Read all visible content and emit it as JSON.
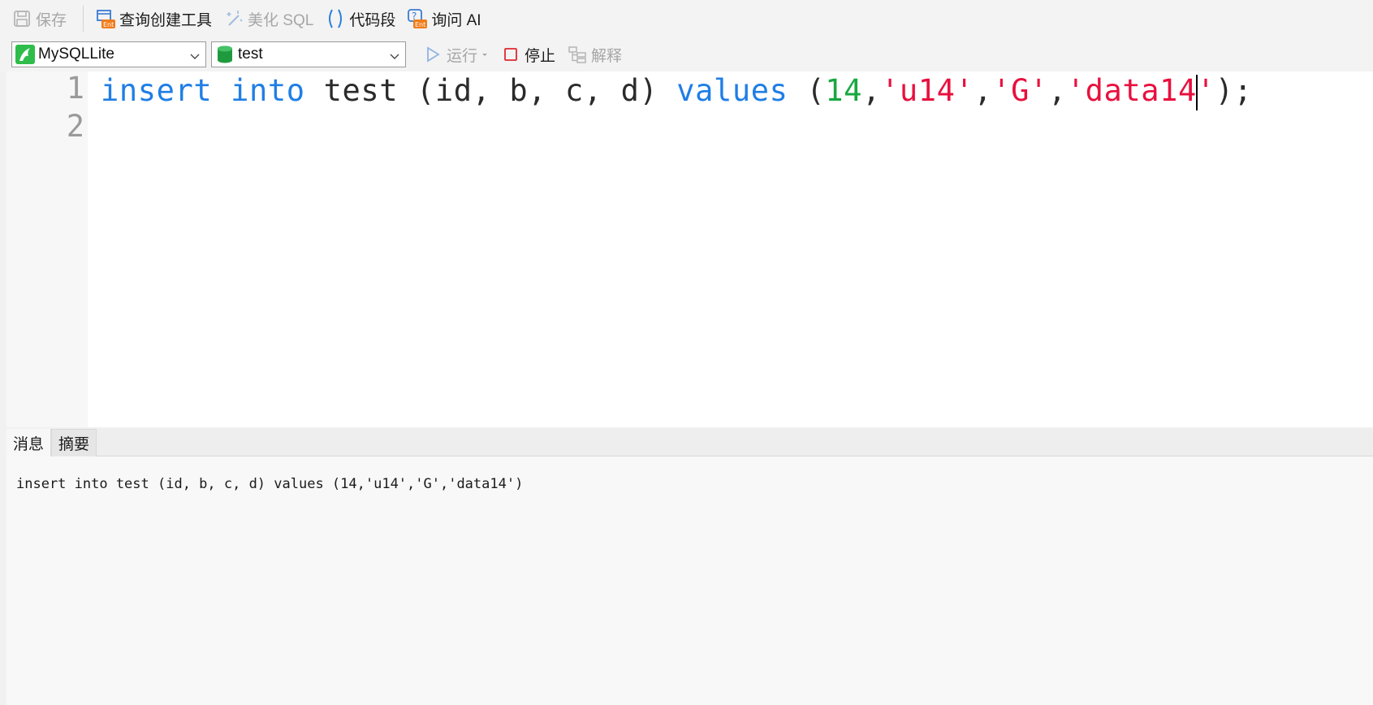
{
  "toolbar": {
    "save_label": "保存",
    "query_builder_label": "查询创建工具",
    "beautify_label": "美化 SQL",
    "snippet_label": "代码段",
    "ask_ai_label": "询问 AI",
    "run_label": "运行",
    "stop_label": "停止",
    "explain_label": "解释"
  },
  "connection": {
    "selected": "MySQLLite"
  },
  "database": {
    "selected": "test"
  },
  "editor": {
    "line_numbers": [
      "1",
      "2"
    ],
    "tokens": {
      "kw_insert": "insert",
      "kw_into": "into",
      "plain1": "test (id, b, c, d)",
      "kw_values": "values",
      "open": "(",
      "num": "14",
      "comma1": ",",
      "str1": "'u14'",
      "comma2": ",",
      "str2": "'G'",
      "comma3": ",",
      "str3a": "'data14",
      "str3b": "'",
      "close": ");"
    }
  },
  "bottom_tabs": {
    "messages": "消息",
    "summary": "摘要"
  },
  "messages": {
    "text": "insert into test (id, b, c, d) values (14,'u14','G','data14')"
  },
  "icons": {
    "save": "save-disk-icon",
    "query_builder": "query-builder-icon",
    "beautify": "magic-wand-icon",
    "snippet": "parentheses-icon",
    "ask_ai": "question-ai-icon",
    "connection": "mysql-dolphin-icon",
    "database": "database-cylinder-icon",
    "run": "play-icon",
    "stop": "stop-square-icon",
    "explain": "explain-tree-icon"
  },
  "colors": {
    "keyword": "#1f7ee6",
    "number": "#18a840",
    "string": "#e8103e",
    "enterprise_badge": "#f07c1a"
  }
}
